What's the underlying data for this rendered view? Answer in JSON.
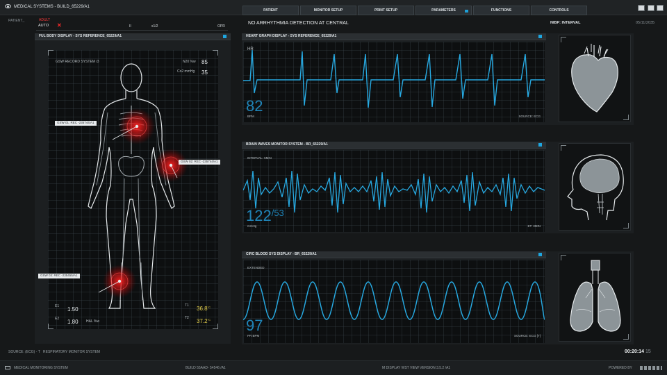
{
  "window": {
    "title": "MEDICAL SYSTEMS - BUILD_65229/A1"
  },
  "tabs": [
    {
      "label": "PATIENT",
      "indicator": false
    },
    {
      "label": "MONITOR SETUP",
      "indicator": false
    },
    {
      "label": "PRINT SETUP",
      "indicator": false
    },
    {
      "label": "PARAMETERS",
      "indicator": true
    },
    {
      "label": "FUNCTIONS",
      "indicator": false
    },
    {
      "label": "CONTROLS",
      "indicator": false
    }
  ],
  "status": {
    "patient_label": "PATIENT_",
    "adult": "ADULT",
    "auto": "AUTO",
    "x_mark": "✕",
    "pause": "II",
    "speed": "x1/2",
    "opr": "OPR",
    "alert": "NO ARRHYTHMIA DETECTION AT CENTRAL",
    "nibp": "NIBP: INTERVAL",
    "date": "05/11/2035"
  },
  "body_panel": {
    "title": "FUL BODY DISPLAY - SYS REFERENCE_65229/A1",
    "record": "GSW RECORD SYSTEM /3",
    "n2o_label": "N20 %w",
    "n2o_value": "85",
    "co2_label": "Co2 mmHg",
    "co2_value": "35",
    "gsw1": "GSW 01: REC -235744/A1",
    "gsw2": "GSW 02: REC -235744/A1",
    "gsw3": "GSW 03: REC -235455/A1",
    "e1_label": "E1",
    "e1_value": "1.50",
    "e2_label": "E2",
    "e2_value": "1.80",
    "hal_label": "HAL %w",
    "t1_label": "T1",
    "t1_value": "36.8",
    "t2_label": "T2",
    "t2_value": "37.2",
    "temp_unit": "°C"
  },
  "heart_panel": {
    "title": "HEART GRAPH DISPLAY - SYS REFERENCE_65229/A1",
    "hr_label": "HR",
    "value": "82",
    "unit": "BPM",
    "source": "SOURCE: ECG"
  },
  "brain_panel": {
    "title": "BRAIN WAVES MONITOR SYSTEM - BR_65229/A1",
    "interval": "INTERVAL: 5MIN",
    "value_main": "122",
    "value_sub": "/53",
    "unit": "mmHg",
    "et": "ET: 3MIN"
  },
  "blood_panel": {
    "title": "CIRC BLOOD SYS DISPLAY - BR_65229/A1",
    "extended": "EXTENDED",
    "value": "97",
    "unit": "PR BPM",
    "source": "SOURCE: ECG [T]"
  },
  "bottom": {
    "source": "SOURCE: (ECG) - T",
    "resp": "RESPIRATORY MONITOR SYSTEM",
    "timer": "00:20:14",
    "timer_frac": "15",
    "app": "MEDICAL MONITORING SYSTEM",
    "build": "BUILD 55AAD- 54546 /A1",
    "version": "M DISPLAY WST VIEW  VERSION 3.5.2 /A1",
    "powered": "POWERED BY"
  },
  "colors": {
    "accent": "#1ea6e0",
    "wave": "#27a9e1",
    "alert_red": "#ff2a2a",
    "temp_yellow": "#e8d24a"
  }
}
